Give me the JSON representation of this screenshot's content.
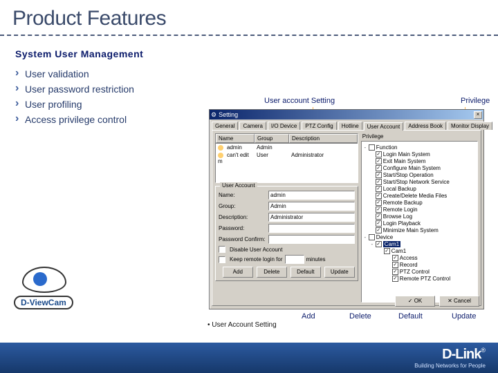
{
  "slide": {
    "title": "Product Features",
    "section": "System User Management",
    "bullets": [
      "User validation",
      "User password restriction",
      "User profiling",
      "Access privilege control"
    ],
    "caption": "• User Account Setting"
  },
  "callouts": {
    "top_left": "User account Setting",
    "top_right": "Privilege",
    "add": "Add",
    "delete": "Delete",
    "default": "Default",
    "update": "Update"
  },
  "dialog": {
    "title": "Setting",
    "tabs": [
      "General",
      "Camera",
      "I/O Device",
      "PTZ Config",
      "Hotline",
      "User Account",
      "Address Book",
      "Monitor Display"
    ],
    "active_tab": 5,
    "list": {
      "columns": [
        "Name",
        "Group",
        "Description"
      ],
      "rows": [
        {
          "name": "admin",
          "group": "Admin",
          "desc": ""
        },
        {
          "name": "can't edit m",
          "group": "User",
          "desc": "Administrator"
        }
      ]
    },
    "account_group_label": "User Account",
    "fields": {
      "name": {
        "label": "Name:",
        "value": "admin"
      },
      "group": {
        "label": "Group:",
        "value": "Admin"
      },
      "description": {
        "label": "Description:",
        "value": "Administrator"
      },
      "password": {
        "label": "Password:",
        "value": ""
      },
      "password_confirm": {
        "label": "Password Confirm:",
        "value": ""
      }
    },
    "disable_user": {
      "label": "Disable User Account",
      "checked": false
    },
    "keep_login": {
      "label": "Keep remote login for",
      "suffix": "minutes"
    },
    "buttons": {
      "add": "Add",
      "delete": "Delete",
      "default": "Default",
      "update": "Update"
    },
    "privilege_label": "Privilege",
    "tree": [
      {
        "text": "Function",
        "level": 0,
        "expand": "-"
      },
      {
        "text": "Login Main System",
        "level": 1,
        "checked": true
      },
      {
        "text": "Exit Main System",
        "level": 1,
        "checked": true
      },
      {
        "text": "Configure Main System",
        "level": 1,
        "checked": true
      },
      {
        "text": "Start/Stop Operation",
        "level": 1,
        "checked": true
      },
      {
        "text": "Start/Stop Network Service",
        "level": 1,
        "checked": true
      },
      {
        "text": "Local Backup",
        "level": 1,
        "checked": true
      },
      {
        "text": "Create/Delete Media Files",
        "level": 1,
        "checked": true
      },
      {
        "text": "Remote Backup",
        "level": 1,
        "checked": true
      },
      {
        "text": "Remote Login",
        "level": 1,
        "checked": true
      },
      {
        "text": "Browse Log",
        "level": 1,
        "checked": true
      },
      {
        "text": "Login Playback",
        "level": 1,
        "checked": true
      },
      {
        "text": "Minimize Main System",
        "level": 1,
        "checked": true
      },
      {
        "text": "Device",
        "level": 0,
        "expand": "-"
      },
      {
        "text": "Cam1",
        "level": 1,
        "selected": true,
        "checked": true,
        "expand": "-"
      },
      {
        "text": "Cam1",
        "level": 2,
        "checked": true
      },
      {
        "text": "Access",
        "level": 3,
        "checked": true
      },
      {
        "text": "Record",
        "level": 3,
        "checked": true
      },
      {
        "text": "PTZ Control",
        "level": 3,
        "checked": true
      },
      {
        "text": "Remote PTZ Control",
        "level": 3,
        "checked": true
      }
    ],
    "ok": "OK",
    "cancel": "Cancel"
  },
  "branding": {
    "dviewcam": "D-ViewCam",
    "dlink": "D-Link",
    "tagline": "Building Networks for People"
  }
}
